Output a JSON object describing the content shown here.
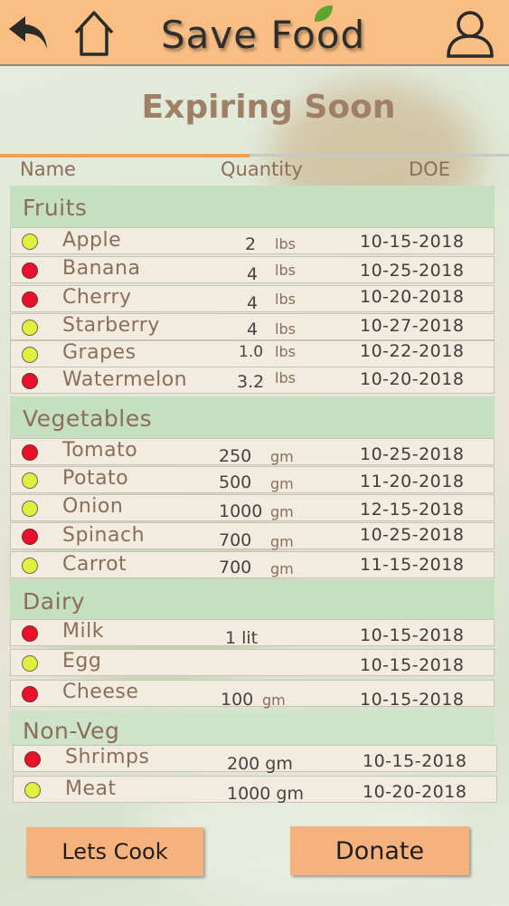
{
  "header": {
    "title_part1": "Save F",
    "title_part2": "o",
    "title_part3": "od",
    "back_icon": "back-arrow-icon",
    "home_icon": "home-icon",
    "profile_icon": "user-profile-icon",
    "colors": {
      "header_bg": "#f9be83",
      "leaf": "#5aa62c"
    }
  },
  "page": {
    "title": "Expiring Soon"
  },
  "columns": {
    "name": "Name",
    "quantity": "Quantity",
    "doe": "DOE"
  },
  "status_colors": {
    "red": "#e8102a",
    "yellow": "#e3ef3f"
  },
  "sections": [
    {
      "title": "Fruits",
      "items": [
        {
          "status": "yellow",
          "name": "Apple",
          "qty": "2",
          "unit": "lbs",
          "doe": "10-15-2018"
        },
        {
          "status": "red",
          "name": "Banana",
          "qty": "4",
          "unit": "lbs",
          "doe": "10-25-2018"
        },
        {
          "status": "red",
          "name": "Cherry",
          "qty": "4",
          "unit": "lbs",
          "doe": "10-20-2018"
        },
        {
          "status": "yellow",
          "name": "Starberry",
          "qty": "4",
          "unit": "lbs",
          "doe": "10-27-2018"
        },
        {
          "status": "yellow",
          "name": "Grapes",
          "qty": "1.0",
          "unit": "lbs",
          "doe": "10-22-2018"
        },
        {
          "status": "red",
          "name": "Watermelon",
          "qty": "3.2",
          "unit": "lbs",
          "doe": "10-20-2018"
        }
      ]
    },
    {
      "title": "Vegetables",
      "items": [
        {
          "status": "red",
          "name": "Tomato",
          "qty": "250",
          "unit": "gm",
          "doe": "10-25-2018"
        },
        {
          "status": "yellow",
          "name": "Potato",
          "qty": "500",
          "unit": "gm",
          "doe": "11-20-2018"
        },
        {
          "status": "yellow",
          "name": "Onion",
          "qty": "1000",
          "unit": "gm",
          "doe": "12-15-2018"
        },
        {
          "status": "red",
          "name": "Spinach",
          "qty": "700",
          "unit": "gm",
          "doe": "10-25-2018"
        },
        {
          "status": "yellow",
          "name": "Carrot",
          "qty": "700",
          "unit": "gm",
          "doe": "11-15-2018"
        }
      ]
    },
    {
      "title": "Dairy",
      "items": [
        {
          "status": "red",
          "name": "Milk",
          "qty": "1 lit",
          "unit": "",
          "doe": "10-15-2018"
        },
        {
          "status": "yellow",
          "name": "Egg",
          "qty": "",
          "unit": "",
          "doe": "10-15-2018"
        },
        {
          "status": "red",
          "name": "Cheese",
          "qty": "100",
          "unit": "gm",
          "doe": "10-15-2018"
        }
      ]
    },
    {
      "title": "Non-Veg",
      "items": [
        {
          "status": "red",
          "name": "Shrimps",
          "qty": "200 gm",
          "unit": "",
          "doe": "10-15-2018"
        },
        {
          "status": "yellow",
          "name": "Meat",
          "qty": "1000 gm",
          "unit": "",
          "doe": "10-20-2018"
        }
      ]
    }
  ],
  "buttons": {
    "cook": "Lets Cook",
    "donate": "Donate"
  }
}
